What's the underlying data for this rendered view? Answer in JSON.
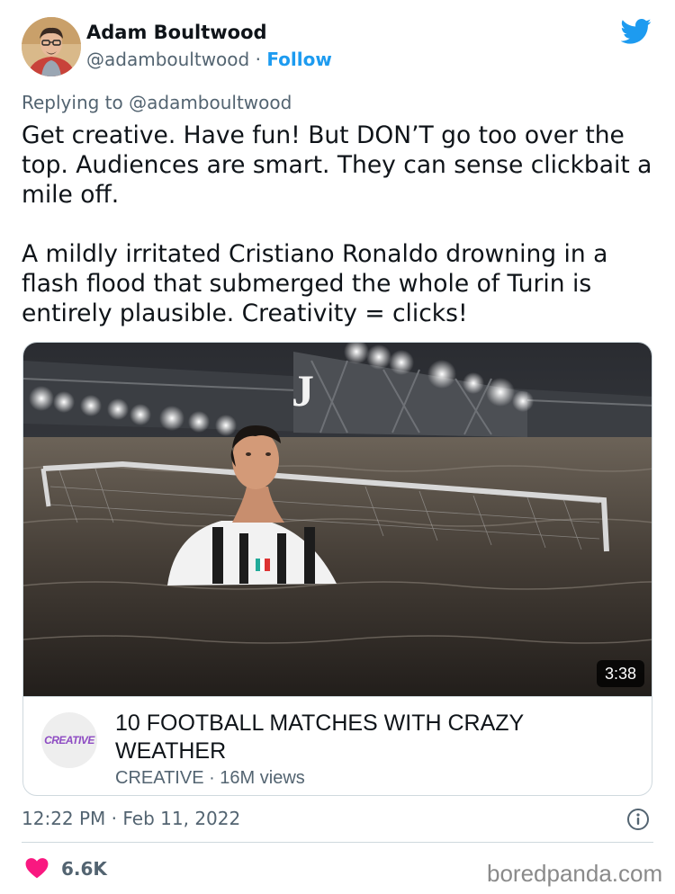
{
  "author": {
    "name": "Adam Boultwood",
    "handle": "@adamboultwood",
    "separator": " · ",
    "follow_label": "Follow"
  },
  "reply_to": "Replying to @adamboultwood",
  "body": "Get creative. Have fun! But DON’T go too over the top. Audiences are smart. They can sense clickbait a mile off.\n\nA mildly irritated Cristiano Ronaldo drowning in a flash flood that submerged the whole of Turin is entirely plausible. Creativity = clicks!",
  "card": {
    "duration": "3:38",
    "channel_logo_text": "CREATIVE",
    "title": "10 FOOTBALL MATCHES WITH CRAZY WEATHER",
    "meta": "CREATIVE · 16M views"
  },
  "timestamp": "12:22 PM · Feb 11, 2022",
  "likes": "6.6K",
  "watermark": "boredpanda.com",
  "colors": {
    "accent": "#1d9bf0",
    "like": "#f91880",
    "secondary_text": "#536471"
  },
  "icons": {
    "brand": "twitter-bird-icon",
    "like": "heart-icon",
    "info": "info-icon"
  }
}
